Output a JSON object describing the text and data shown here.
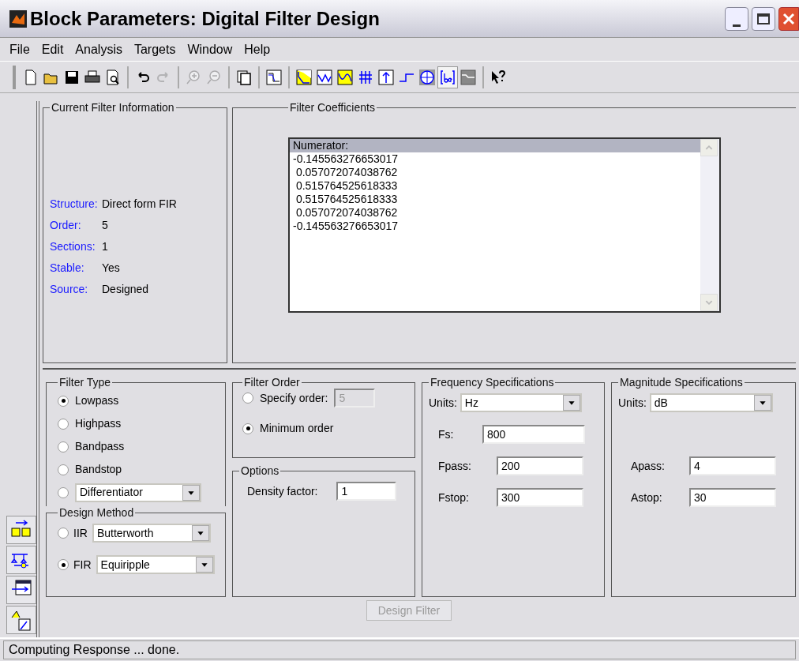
{
  "window": {
    "title": "Block Parameters: Digital Filter Design"
  },
  "menu": [
    "File",
    "Edit",
    "Analysis",
    "Targets",
    "Window",
    "Help"
  ],
  "toolbar_groups": [
    {
      "buttons": [
        {
          "kind": "new",
          "disabled": false,
          "selected": false
        },
        {
          "kind": "open",
          "disabled": false,
          "selected": false
        },
        {
          "kind": "save",
          "disabled": false,
          "selected": false
        },
        {
          "kind": "print",
          "disabled": false,
          "selected": false
        },
        {
          "kind": "preview",
          "disabled": false,
          "selected": false
        }
      ]
    },
    {
      "buttons": [
        {
          "kind": "undo",
          "disabled": false,
          "selected": false
        },
        {
          "kind": "redo",
          "disabled": true,
          "selected": false
        }
      ]
    },
    {
      "buttons": [
        {
          "kind": "zoom-in",
          "disabled": true,
          "selected": false
        },
        {
          "kind": "zoom-out",
          "disabled": true,
          "selected": false
        }
      ]
    },
    {
      "buttons": [
        {
          "kind": "pages",
          "disabled": false,
          "selected": false
        }
      ]
    },
    {
      "buttons": [
        {
          "kind": "spec",
          "disabled": false,
          "selected": false
        }
      ]
    },
    {
      "buttons": [
        {
          "kind": "magnitude",
          "disabled": false,
          "selected": false
        },
        {
          "kind": "phase",
          "disabled": false,
          "selected": false
        },
        {
          "kind": "magphase",
          "disabled": false,
          "selected": false
        },
        {
          "kind": "delay",
          "disabled": false,
          "selected": false
        },
        {
          "kind": "impulse",
          "disabled": false,
          "selected": false
        },
        {
          "kind": "step",
          "disabled": false,
          "selected": false
        },
        {
          "kind": "polezero",
          "disabled": false,
          "selected": false
        },
        {
          "kind": "coeffs",
          "disabled": false,
          "selected": true
        },
        {
          "kind": "info",
          "disabled": false,
          "selected": false
        }
      ]
    },
    {
      "buttons": [
        {
          "kind": "whatsthis",
          "disabled": false,
          "selected": false
        }
      ]
    }
  ],
  "side_buttons": [
    {
      "kind": "transform"
    },
    {
      "kind": "realize"
    },
    {
      "kind": "import"
    },
    {
      "kind": "design"
    }
  ],
  "filter_info": {
    "title": "Current Filter Information",
    "rows": [
      {
        "label": "Structure:",
        "value": "Direct form FIR"
      },
      {
        "label": "Order:",
        "value": "5"
      },
      {
        "label": "Sections:",
        "value": "1"
      },
      {
        "label": "Stable:",
        "value": "Yes"
      },
      {
        "label": "Source:",
        "value": "Designed"
      }
    ]
  },
  "coefficients": {
    "title": "Filter Coefficients",
    "items": [
      {
        "text": "Numerator:",
        "selected": true
      },
      {
        "text": "-0.145563276653017",
        "selected": false
      },
      {
        "text": " 0.057072074038762",
        "selected": false
      },
      {
        "text": " 0.515764525618333",
        "selected": false
      },
      {
        "text": " 0.515764525618333",
        "selected": false
      },
      {
        "text": " 0.057072074038762",
        "selected": false
      },
      {
        "text": "-0.145563276653017",
        "selected": false
      }
    ]
  },
  "filter_type": {
    "title": "Filter Type",
    "options": [
      {
        "kind": "radio",
        "label": "Lowpass",
        "selected": true
      },
      {
        "kind": "radio",
        "label": "Highpass",
        "selected": false
      },
      {
        "kind": "radio",
        "label": "Bandpass",
        "selected": false
      },
      {
        "kind": "radio",
        "label": "Bandstop",
        "selected": false
      },
      {
        "kind": "dropdown",
        "value": "Differentiator",
        "selected": false
      }
    ]
  },
  "design_method": {
    "title": "Design Method",
    "options": [
      {
        "label": "IIR",
        "value": "Butterworth",
        "selected": false
      },
      {
        "label": "FIR",
        "value": "Equiripple",
        "selected": true
      }
    ]
  },
  "filter_order": {
    "title": "Filter Order",
    "options": [
      {
        "kind": "field",
        "label": "Specify order:",
        "value": "5",
        "disabled": true,
        "selected": false
      },
      {
        "kind": "radio",
        "label": "Minimum order",
        "selected": true
      }
    ]
  },
  "options": {
    "title": "Options",
    "fields": [
      {
        "label": "Density factor:",
        "value": "1"
      }
    ]
  },
  "frequency": {
    "title": "Frequency Specifications",
    "units_label": "Units:",
    "units": "Hz",
    "fields": [
      {
        "label": "Fs:",
        "value": "800"
      },
      {
        "label": "Fpass:",
        "value": "200"
      },
      {
        "label": "Fstop:",
        "value": "300"
      }
    ]
  },
  "magnitude": {
    "title": "Magnitude Specifications",
    "units_label": "Units:",
    "units": "dB",
    "fields": [
      {
        "label": "Apass:",
        "value": "4"
      },
      {
        "label": "Astop:",
        "value": "30"
      }
    ]
  },
  "design_button": {
    "label": "Design Filter",
    "disabled": true
  },
  "status_bar": "Computing Response ... done."
}
